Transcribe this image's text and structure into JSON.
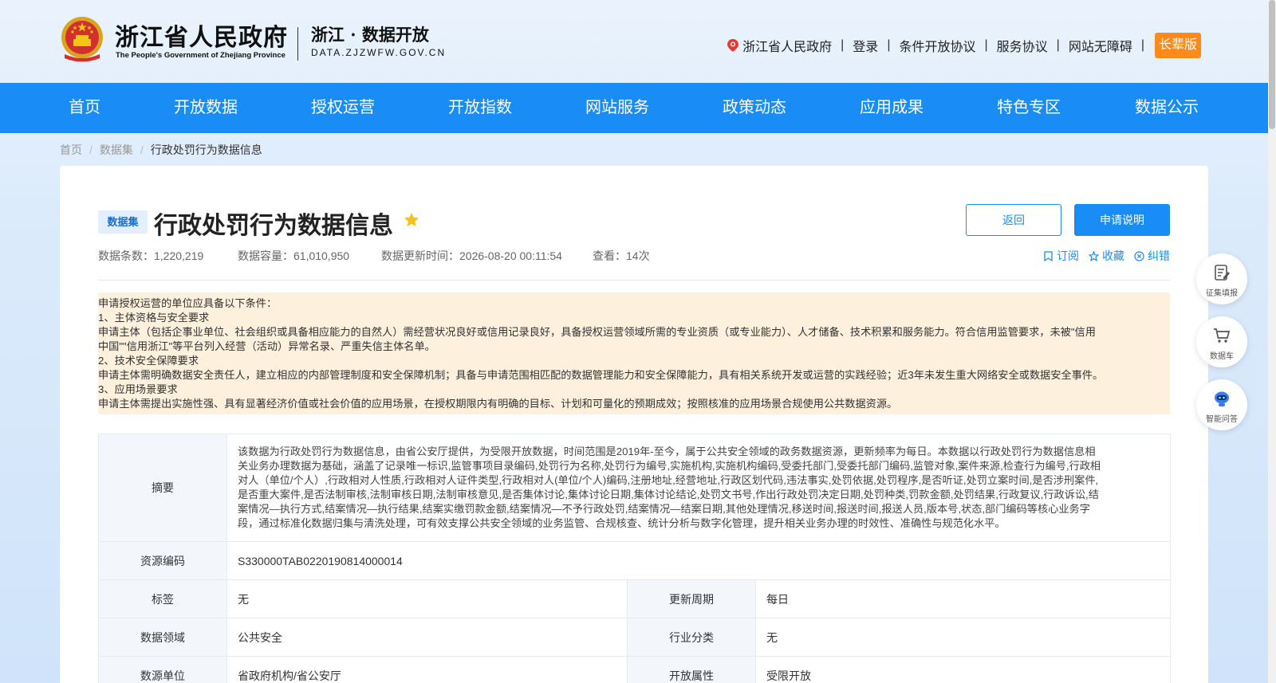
{
  "header": {
    "gov_title": "浙江省人民政府",
    "gov_subtitle": "The People's Government of Zhejiang Province",
    "portal_title": "浙江 · 数据开放",
    "portal_domain": "DATA.ZJZWFW.GOV.CN",
    "links": {
      "gov": "浙江省人民政府",
      "login": "登录",
      "conditional_agreement": "条件开放协议",
      "service_agreement": "服务协议",
      "accessibility": "网站无障碍",
      "elder_mode": "长辈版"
    },
    "separator": "|"
  },
  "nav": {
    "items": [
      {
        "label": "首页"
      },
      {
        "label": "开放数据"
      },
      {
        "label": "授权运营"
      },
      {
        "label": "开放指数"
      },
      {
        "label": "网站服务"
      },
      {
        "label": "政策动态"
      },
      {
        "label": "应用成果"
      },
      {
        "label": "特色专区"
      },
      {
        "label": "数据公示"
      }
    ],
    "color": "#1a8cf5"
  },
  "breadcrumb": {
    "items": [
      "首页",
      "数据集",
      "行政处罚行为数据信息"
    ],
    "separator": "/"
  },
  "dataset": {
    "tag": "数据集",
    "title": "行政处罚行为数据信息",
    "back_label": "返回",
    "apply_label": "申请说明",
    "meta": {
      "records": "数据条数：1,220,219",
      "capacity": "数据容量：61,010,950",
      "updated": "数据更新时间：2026-08-20 00:11:54",
      "views": "查看：14次"
    },
    "actions": {
      "subscribe": "订阅",
      "favorite": "收藏",
      "correct": "纠错"
    }
  },
  "notice": {
    "lines": [
      "申请授权运营的单位应具备以下条件：",
      "1、主体资格与安全要求",
      "申请主体（包括企事业单位、社会组织或具备相应能力的自然人）需经营状况良好或信用记录良好，具备授权运营领域所需的专业资质（或专业能力）、人才储备、技术积累和服务能力。符合信用监管要求，未被\"信用",
      "中国\"\"信用浙江\"等平台列入经营（活动）异常名录、严重失信主体名单。",
      "2、技术安全保障要求",
      "申请主体需明确数据安全责任人，建立相应的内部管理制度和安全保障机制；具备与申请范围相匹配的数据管理能力和安全保障能力，具有相关系统开发或运营的实践经验；近3年未发生重大网络安全或数据安全事件。",
      "3、应用场景要求",
      "申请主体需提出实施性强、具有显著经济价值或社会价值的应用场景，在授权期限内有明确的目标、计划和可量化的预期成效；按照核准的应用场景合规使用公共数据资源。"
    ],
    "background": "#fdf0dd"
  },
  "info": {
    "abstract_label": "摘要",
    "abstract_lines": [
      "该数据为行政处罚行为数据信息，由省公安厅提供，为受限开放数据，时间范围是2019年-至今，属于公共安全领域的政务数据资源，更新频率为每日。本数据以行政处罚行为数据信息相",
      "关业务办理数据为基础，涵盖了记录唯一标识,监管事项目录编码,处罚行为名称,处罚行为编号,实施机构,实施机构编码,受委托部门,受委托部门编码,监管对象,案件来源,检查行为编号,行政相",
      "对人（单位/个人）,行政相对人性质,行政相对人证件类型,行政相对人(单位/个人)编码,注册地址,经营地址,行政区划代码,违法事实,处罚依据,处罚程序,是否听证,处罚立案时间,是否涉刑案件,",
      "是否重大案件,是否法制审核,法制审核日期,法制审核意见,是否集体讨论,集体讨论日期,集体讨论结论,处罚文书号,作出行政处罚决定日期,处罚种类,罚款金额,处罚结果,行政复议,行政诉讼,结",
      "案情况—执行方式,结案情况—执行结果,结案实缴罚款金额,结案情况—不予行政处罚,结案情况—结案日期,其他处理情况,移送时间,报送时间,报送人员,版本号,状态,部门编码等核心业务字",
      "段，通过标准化数据归集与清洗处理，可有效支撑公共安全领域的业务监管、合规核查、统计分析与数字化管理，提升相关业务办理的时效性、准确性与规范化水平。"
    ],
    "resource_code_label": "资源编码",
    "resource_code": "S330000TAB0220190814000014",
    "tag_label": "标签",
    "tag_value": "无",
    "update_cycle_label": "更新周期",
    "update_cycle": "每日",
    "domain_label": "数据领域",
    "domain_value": "公共安全",
    "industry_label": "行业分类",
    "industry_value": "无",
    "unit_label": "数源单位",
    "unit_value": "省政府机构/省公安厅",
    "open_attr_label": "开放属性",
    "open_attr_value": "受限开放"
  },
  "float_tools": {
    "collect": "征集填报",
    "data_cart": "数据车",
    "smart_qa": "智能问答"
  }
}
